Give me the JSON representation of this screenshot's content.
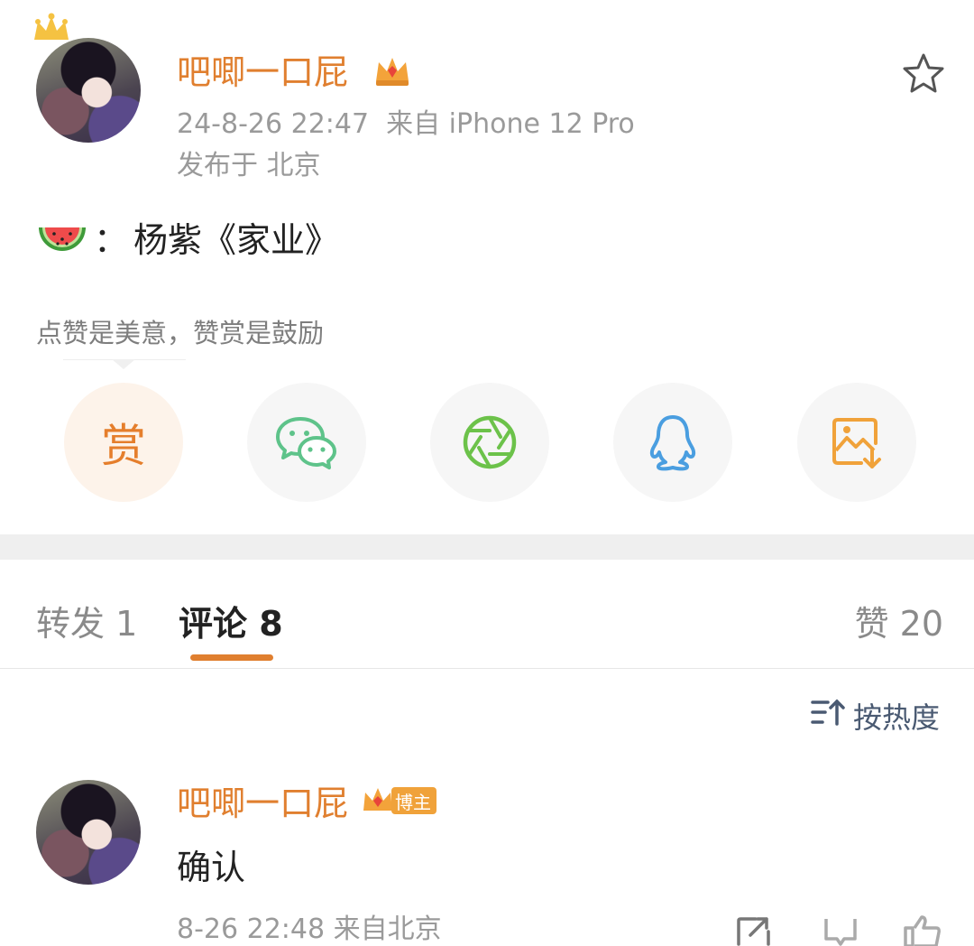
{
  "post": {
    "author": "吧唧一口屁",
    "time_source": "24-8-26 22:47  来自 iPhone 12 Pro",
    "location": "发布于 北京",
    "content_prefix": "：",
    "content": "杨紫《家业》",
    "reward_hint": "点赞是美意，赞赏是鼓励",
    "reward_label": "赏"
  },
  "share": {
    "items": [
      "reward",
      "wechat",
      "moments",
      "qq",
      "save-image"
    ]
  },
  "tabs": {
    "repost": "转发 1",
    "comments": "评论 8",
    "likes": "赞 20"
  },
  "sort": {
    "label": "按热度"
  },
  "comment": {
    "author": "吧唧一口屁",
    "badge": "博主",
    "text": "确认",
    "meta": "8-26 22:48 来自北京"
  },
  "colors": {
    "accent": "#e07f2f",
    "wechat": "#5ec38a",
    "moments": "#6cc24a",
    "qq": "#4a9ee0",
    "save": "#f0a23a"
  }
}
